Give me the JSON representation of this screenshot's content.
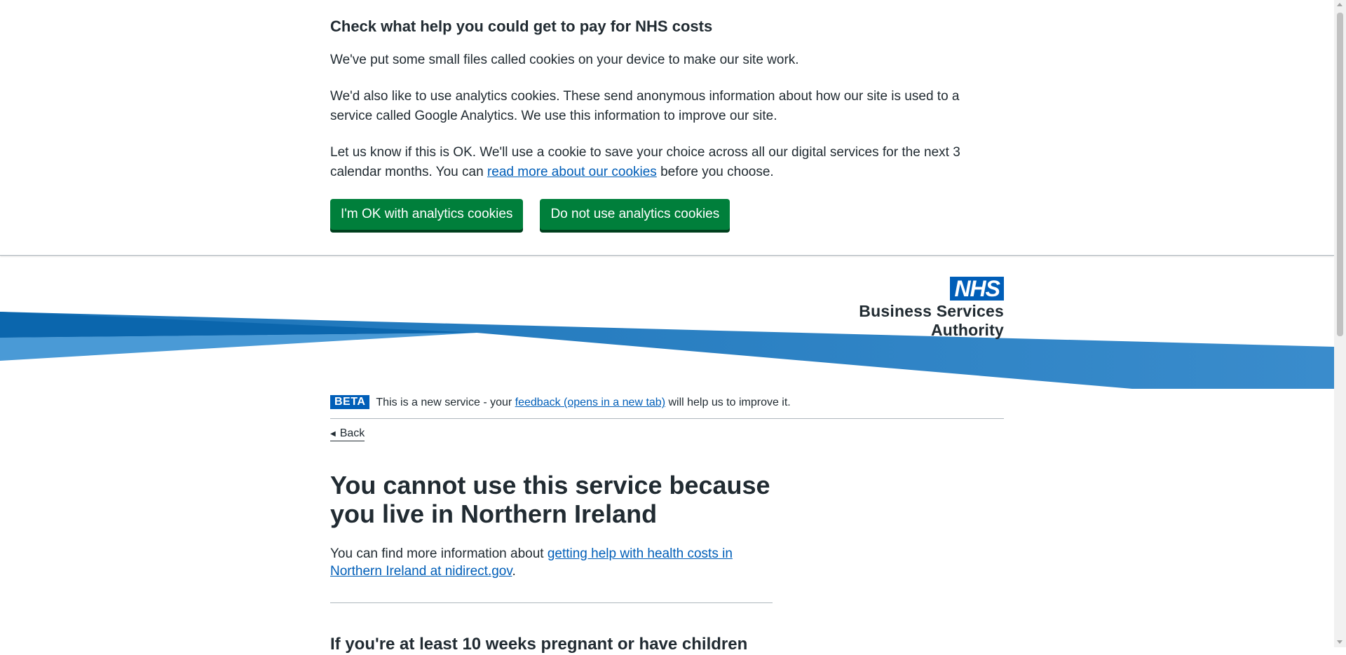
{
  "cookie_banner": {
    "title": "Check what help you could get to pay for NHS costs",
    "p1": "We've put some small files called cookies on your device to make our site work.",
    "p2": "We'd also like to use analytics cookies. These send anonymous information about how our site is used to a service called Google Analytics. We use this information to improve our site.",
    "p3_before": "Let us know if this is OK. We'll use a cookie to save your choice across all our digital services for the next 3 calendar months. You can ",
    "p3_link": "read more about our cookies",
    "p3_after": " before you choose.",
    "accept_label": "I'm OK with analytics cookies",
    "reject_label": "Do not use analytics cookies"
  },
  "header": {
    "nhs_logo_text": "NHS",
    "org_name": "Business Services Authority"
  },
  "phase_banner": {
    "tag": "BETA",
    "text_before": "This is a new service - your ",
    "link": "feedback (opens in a new tab)",
    "text_after": " will help us to improve it."
  },
  "back_link": "Back",
  "main": {
    "title": "You cannot use this service because you live in Northern Ireland",
    "p_before": "You can find more information about ",
    "p_link": "getting help with health costs in Northern Ireland at nidirect.gov",
    "p_after": ".",
    "subheading": "If you're at least 10 weeks pregnant or have children"
  },
  "colors": {
    "nhs_blue": "#005eb8",
    "button_green": "#007f3b",
    "text": "#212b32"
  }
}
